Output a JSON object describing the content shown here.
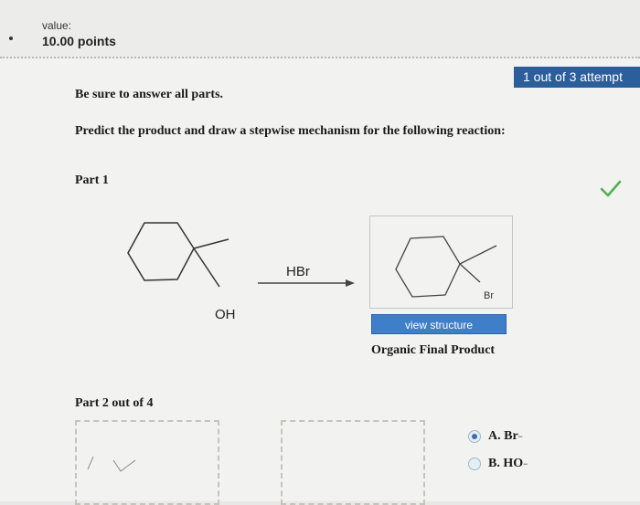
{
  "header": {
    "value_label": "value:",
    "points": "10.00 points"
  },
  "attempt_badge": "1 out of 3 attempt",
  "instructions": [
    "Be sure to answer all parts.",
    "Predict the product and draw a stepwise mechanism for the following reaction:"
  ],
  "part1": {
    "title": "Part 1",
    "reagent": "HBr",
    "reactant_group": "OH",
    "product_group": "Br",
    "view_structure": "view structure",
    "product_label": "Organic Final Product",
    "status_icon": "checkmark-icon",
    "status_color": "#4caf50"
  },
  "part2": {
    "title": "Part 2 out of 4",
    "options": [
      {
        "label": "A. Br",
        "charge": "−",
        "selected": true
      },
      {
        "label": "B. HO",
        "charge": "−",
        "selected": false
      }
    ]
  },
  "colors": {
    "accent": "#2b5f9c",
    "button": "#3f7ec9"
  }
}
